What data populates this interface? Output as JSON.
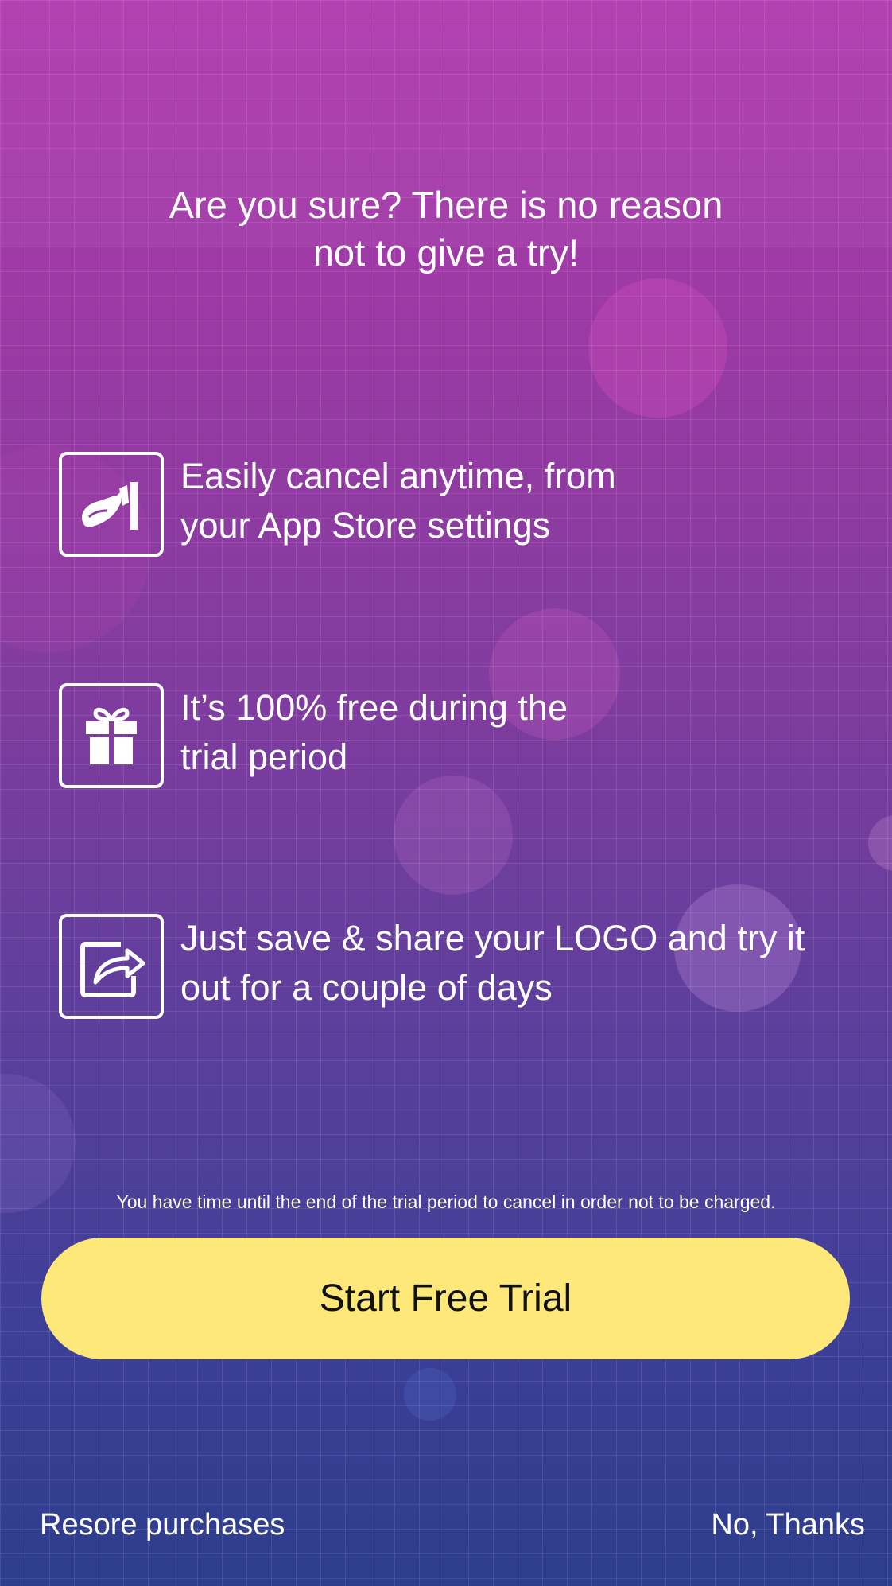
{
  "headline": {
    "line1": "Are you sure? There is no reason",
    "line2": "not to give a try!"
  },
  "features": [
    {
      "icon": "hand-cancel-icon",
      "line1": "Easily cancel anytime, from",
      "line2": "your App Store settings"
    },
    {
      "icon": "gift-icon",
      "line1": "It’s 100% free during the",
      "line2": "trial period"
    },
    {
      "icon": "share-icon",
      "line1": "Just save & share your LOGO and try it",
      "line2": "out for a couple of days"
    }
  ],
  "disclaimer": "You have time until the end of the trial period to cancel in order not to be charged.",
  "cta": {
    "label": "Start Free Trial",
    "color": "#fde879"
  },
  "footer": {
    "restore_label": "Resore purchases",
    "dismiss_label": "No, Thanks"
  },
  "colors": {
    "background_top": "#b03aae",
    "background_bottom": "#2d3d8c",
    "text": "#ffffff"
  }
}
